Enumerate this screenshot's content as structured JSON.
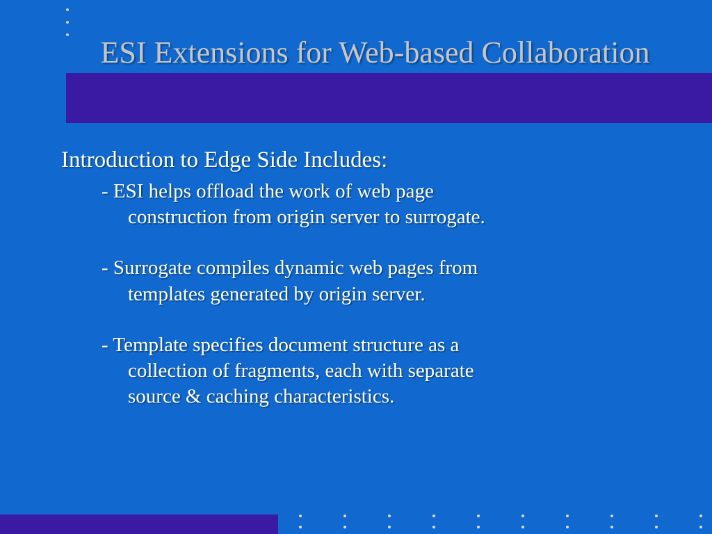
{
  "colors": {
    "background": "#1169cf",
    "accent_bar": "#3a1aa3",
    "title_text": "#c8c6c4",
    "body_text": "#fffff0"
  },
  "title": "ESI Extensions for Web-based Collaboration",
  "intro": "Introduction to Edge Side Includes:",
  "bullets": [
    {
      "dash": "- ",
      "line1": "ESI helps offload the work of web page",
      "line2": "construction from origin server to surrogate."
    },
    {
      "dash": "- ",
      "line1": "Surrogate compiles dynamic web pages from",
      "line2": "templates generated by origin server."
    },
    {
      "dash": "- ",
      "line1": "Template specifies document structure as a",
      "line2": "collection of fragments, each with separate",
      "line3": "source & caching characteristics."
    }
  ]
}
